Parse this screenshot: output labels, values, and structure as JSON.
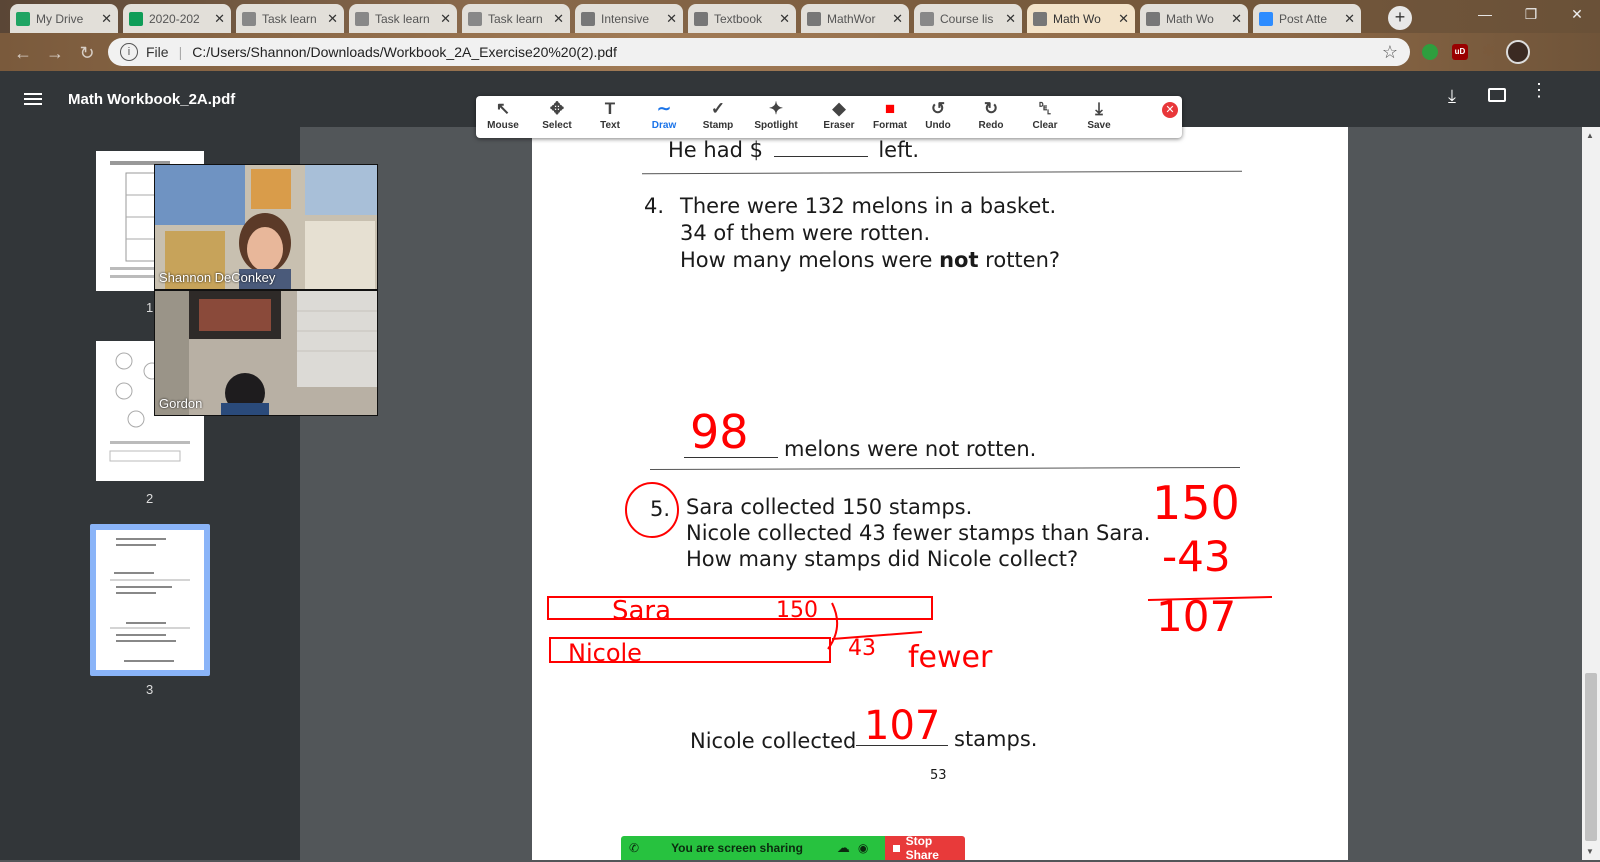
{
  "browser": {
    "tabs": [
      {
        "title": "My Drive",
        "icon": "google-drive-icon",
        "color": "#1fa463"
      },
      {
        "title": "2020-202",
        "icon": "google-sheets-icon",
        "color": "#0f9d58"
      },
      {
        "title": "Task learn",
        "icon": "doc-icon",
        "color": "#888888"
      },
      {
        "title": "Task learn",
        "icon": "doc-icon",
        "color": "#888888"
      },
      {
        "title": "Task learn",
        "icon": "doc-icon",
        "color": "#888888"
      },
      {
        "title": "Intensive",
        "icon": "globe-icon",
        "color": "#777777"
      },
      {
        "title": "Textbook",
        "icon": "globe-icon",
        "color": "#777777"
      },
      {
        "title": "MathWor",
        "icon": "globe-icon",
        "color": "#777777"
      },
      {
        "title": "Course lis",
        "icon": "doc-icon",
        "color": "#888888"
      },
      {
        "title": "Math Wo",
        "icon": "globe-icon",
        "color": "#777777"
      },
      {
        "title": "Math Wo",
        "icon": "globe-icon",
        "color": "#777777"
      },
      {
        "title": "Post Atte",
        "icon": "zoom-icon",
        "color": "#2d8cff"
      }
    ],
    "active_tab_index": 9,
    "url_prefix": "File",
    "url": "C:/Users/Shannon/Downloads/Workbook_2A_Exercise20%20(2).pdf"
  },
  "pdf": {
    "title": "Math Workbook_2A.pdf",
    "thumbnails": [
      {
        "number": "1"
      },
      {
        "number": "2"
      },
      {
        "number": "3"
      }
    ]
  },
  "zoom_toolbar": {
    "tools": [
      {
        "label": "Mouse",
        "icon": "cursor-icon"
      },
      {
        "label": "Select",
        "icon": "move-icon"
      },
      {
        "label": "Text",
        "icon": "text-icon"
      },
      {
        "label": "Draw",
        "icon": "draw-icon"
      },
      {
        "label": "Stamp",
        "icon": "check-icon"
      },
      {
        "label": "Spotlight",
        "icon": "wand-icon"
      },
      {
        "label": "Eraser",
        "icon": "eraser-icon"
      },
      {
        "label": "Format",
        "icon": "color-square-icon"
      },
      {
        "label": "Undo",
        "icon": "undo-icon"
      },
      {
        "label": "Redo",
        "icon": "redo-icon"
      },
      {
        "label": "Clear",
        "icon": "trash-icon"
      },
      {
        "label": "Save",
        "icon": "save-icon"
      }
    ],
    "active_tool": "Draw",
    "accent_color": "#1a73e8",
    "format_color": "#ff0000"
  },
  "participants": [
    {
      "name": "Shannon DeConkey"
    },
    {
      "name": "Gordon"
    }
  ],
  "page": {
    "prev_answer_prefix": "He had $",
    "prev_answer_suffix": "left.",
    "q4_number": "4.",
    "q4_line1": "There were 132 melons in a basket.",
    "q4_line2": "34 of them were rotten.",
    "q4_line3_pre": "How many melons were ",
    "q4_line3_bold": "not",
    "q4_line3_post": " rotten?",
    "q4_answer": "melons were not rotten.",
    "q5_number": "5.",
    "q5_line1": "Sara collected 150 stamps.",
    "q5_line2": "Nicole collected 43 fewer stamps than Sara.",
    "q5_line3": "How many stamps did Nicole collect?",
    "q5_answer_prefix": "Nicole collected",
    "q5_answer_suffix": "stamps.",
    "page_number": "53"
  },
  "annotations": {
    "ink_color": "#ff0000",
    "q4_handwritten": "98",
    "q5_handwritten": "107",
    "bar_label_1": "Sara",
    "bar_value_1": "150",
    "bar_label_2": "Nicole",
    "bar_value_2": "43",
    "fewer_note": "fewer",
    "calc_top": "150",
    "calc_sub": "-43",
    "calc_result": "107"
  },
  "screen_share": {
    "status": "You are screen sharing",
    "stop_label": "Stop Share",
    "status_color": "#27c23f",
    "stop_color": "#e83a3a"
  }
}
